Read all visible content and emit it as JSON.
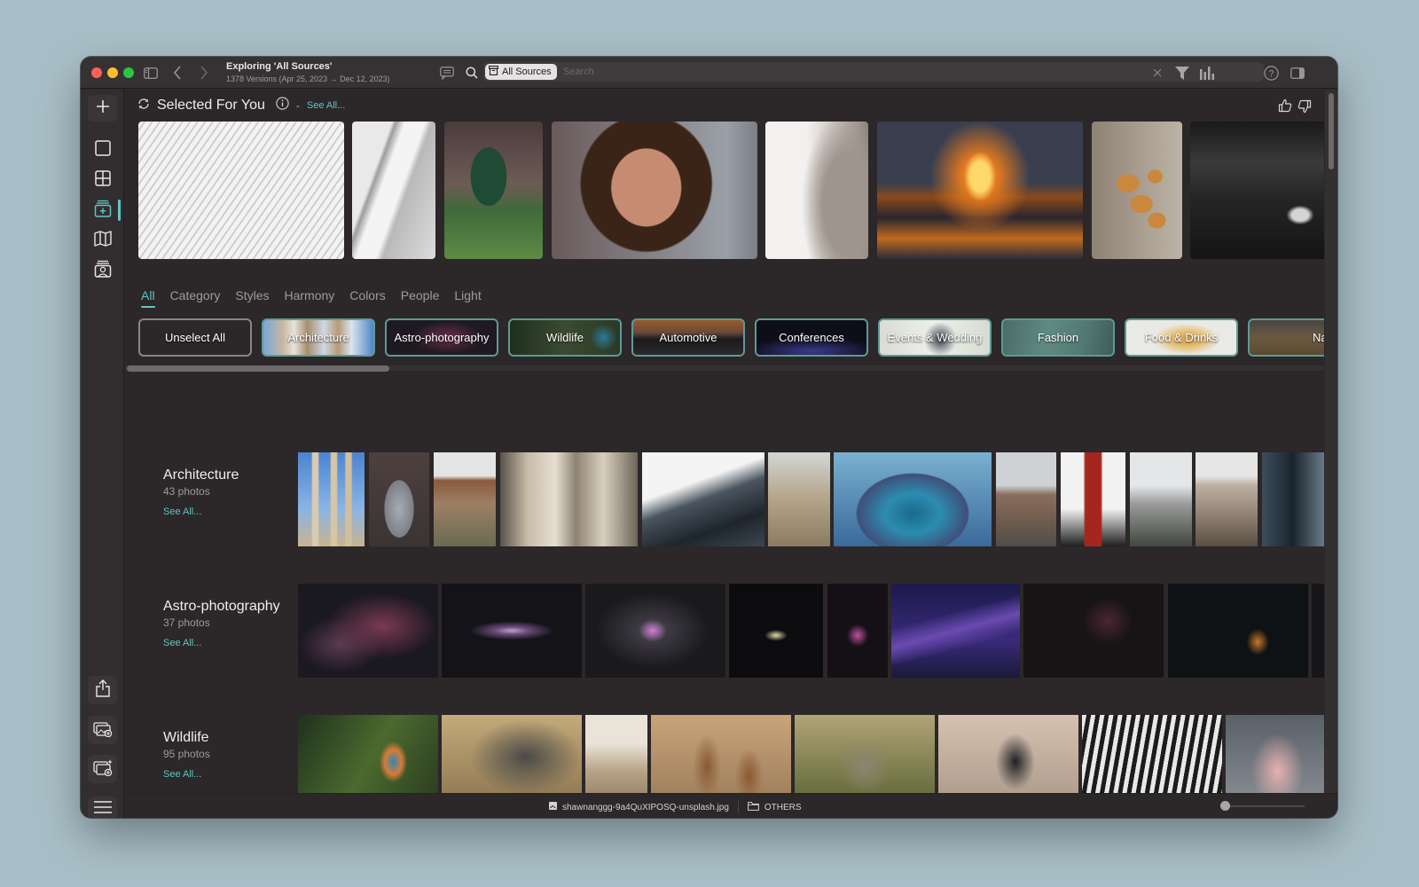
{
  "window": {
    "title": "Exploring 'All Sources'",
    "subtitle": "1378 Versions (Apr 25, 2023 → Dec 12, 2023)"
  },
  "toolbar": {
    "source_filter": "All Sources",
    "search_placeholder": "Search",
    "search_value": "",
    "icons": [
      "sidebar-toggle-icon",
      "chevron-left-icon",
      "chevron-right-icon",
      "comment-icon",
      "search-icon",
      "archive-box-icon",
      "clear-icon",
      "filter-icon",
      "bar-chart-icon",
      "help-icon",
      "inspector-panel-icon"
    ]
  },
  "sidebar": {
    "items": [
      {
        "name": "add",
        "icon": "plus-icon"
      },
      {
        "name": "single-view",
        "icon": "square-icon"
      },
      {
        "name": "grid-view",
        "icon": "grid-icon"
      },
      {
        "name": "explore",
        "icon": "explore-stack-icon",
        "active": true
      },
      {
        "name": "map",
        "icon": "map-icon"
      },
      {
        "name": "people",
        "icon": "people-stack-icon"
      },
      {
        "name": "share",
        "icon": "share-icon"
      },
      {
        "name": "import",
        "icon": "photos-add-icon"
      },
      {
        "name": "import-ai",
        "icon": "photos-sparkle-icon"
      },
      {
        "name": "menu",
        "icon": "hamburger-icon"
      }
    ]
  },
  "selected_for_you": {
    "title": "Selected For You",
    "dash": "-",
    "see_all": "See All...",
    "thumbnails": [
      "white-architecture-curves",
      "white-spiral-stairs",
      "football-player",
      "freckled-portrait",
      "beige-wave-wall",
      "orange-arches-corridor",
      "copper-pendant-lamps",
      "seagull-on-dark-water"
    ]
  },
  "tabs": [
    {
      "label": "All",
      "active": true
    },
    {
      "label": "Category"
    },
    {
      "label": "Styles"
    },
    {
      "label": "Harmony"
    },
    {
      "label": "Colors"
    },
    {
      "label": "People"
    },
    {
      "label": "Light"
    }
  ],
  "chips": [
    {
      "label": "Unselect All"
    },
    {
      "label": "Architecture"
    },
    {
      "label": "Astro-photography"
    },
    {
      "label": "Wildlife"
    },
    {
      "label": "Automotive"
    },
    {
      "label": "Conferences"
    },
    {
      "label": "Events & Wedding"
    },
    {
      "label": "Fashion"
    },
    {
      "label": "Food & Drinks"
    },
    {
      "label": "Nature"
    }
  ],
  "categories": [
    {
      "title": "Architecture",
      "count": "43 photos",
      "see_all": "See All..."
    },
    {
      "title": "Astro-photography",
      "count": "37 photos",
      "see_all": "See All..."
    },
    {
      "title": "Wildlife",
      "count": "95 photos",
      "see_all": "See All..."
    }
  ],
  "status": {
    "filename": "shawnanggg-9a4QuXIPOSQ-unsplash.jpg",
    "folder": "OTHERS"
  },
  "colors": {
    "accent": "#5fc7c4",
    "window_bg": "#2c2729",
    "titlebar_bg": "#363234"
  }
}
